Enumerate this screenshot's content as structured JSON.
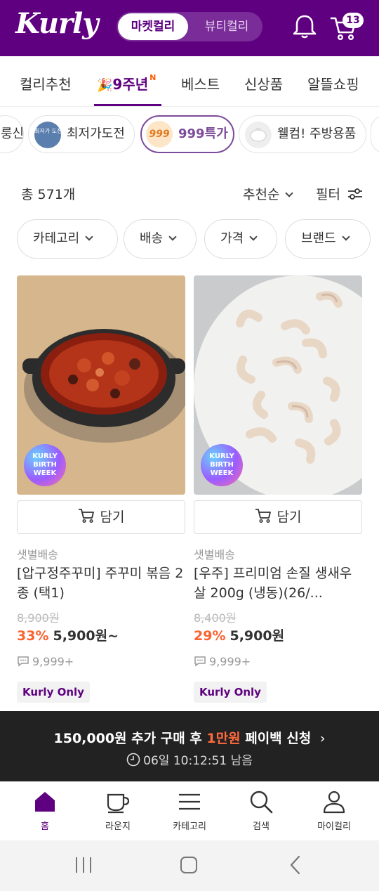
{
  "header": {
    "logo": "Kurly",
    "segment_active": "마켓컬리",
    "segment_inactive": "뷰티컬리",
    "cart_count": "13"
  },
  "tabs": [
    "컬리추천",
    "9주년",
    "베스트",
    "신상품",
    "알뜰쇼핑"
  ],
  "tab_new_mark": "N",
  "chips": {
    "partial_left": "룽신",
    "lowest": "최저가도전",
    "lowest_thumb_text": "최저가 도전",
    "special": "999특가",
    "special_thumb_text": "999",
    "welcome": "웰컴! 주방용품"
  },
  "summary": {
    "total": "총 571개",
    "sort": "추천순",
    "filter": "필터"
  },
  "filters": [
    "카테고리",
    "배송",
    "가격",
    "브랜드"
  ],
  "products": [
    {
      "delivery": "샛별배송",
      "name": "[압구정주꾸미] 주꾸미 볶음 2종 (택1)",
      "original_price": "8,900원",
      "discount": "33%",
      "price": "5,900원~",
      "reviews": "9,999+",
      "badge": "Kurly Only",
      "event_badge": "KURLY BIRTH WEEK",
      "cart_label": "담기"
    },
    {
      "delivery": "샛별배송",
      "name": "[우주] 프리미엄 손질 생새우살 200g (냉동)(26/...",
      "original_price": "8,400원",
      "discount": "29%",
      "price": "5,900원",
      "reviews": "9,999+",
      "badge": "Kurly Only",
      "event_badge": "KURLY BIRTH WEEK",
      "cart_label": "담기"
    }
  ],
  "banner": {
    "line1_prefix": "150,000원 추가 구매 후 ",
    "line1_highlight": "1만원",
    "line1_suffix": " 페이백 신청",
    "timer": "06일 10:12:51 남음"
  },
  "bottom_nav": [
    "홈",
    "라운지",
    "카테고리",
    "검색",
    "마이컬리"
  ],
  "colors": {
    "brand": "#5f0080",
    "discount": "#fa622f",
    "banner_bg": "#222222"
  }
}
